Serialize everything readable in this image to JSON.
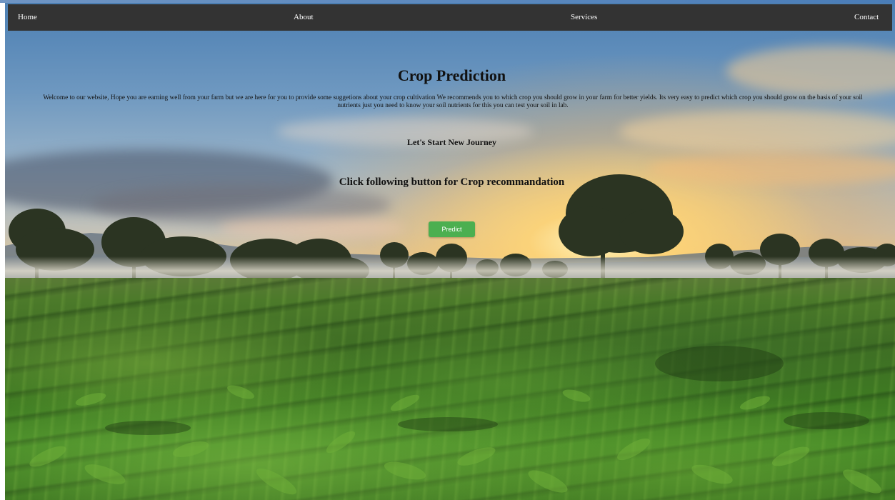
{
  "nav": {
    "items": [
      {
        "label": "Home"
      },
      {
        "label": "About"
      },
      {
        "label": "Services"
      },
      {
        "label": "Contact"
      }
    ]
  },
  "hero": {
    "title": "Crop Prediction",
    "intro": "Welcome to our website, Hope you are earning well from your farm but we are here for you to provide some suggetions about your crop cultivation We recommends you to which crop you should grow in your farm for better yields. Its very easy to predict which crop you should grow on the basis of your soil nutrients just you need to know your soil nutrients for this you can test your soil in lab.",
    "subheading": "Let's Start New Journey",
    "cta_text": "Click following button for Crop recommandation",
    "predict_label": "Predict"
  },
  "colors": {
    "navbar": "#333333",
    "nav_text": "#ffffff",
    "button": "#4caf50",
    "heading_text": "#111111"
  },
  "background": {
    "scene": "farmland-sunrise-photo"
  }
}
